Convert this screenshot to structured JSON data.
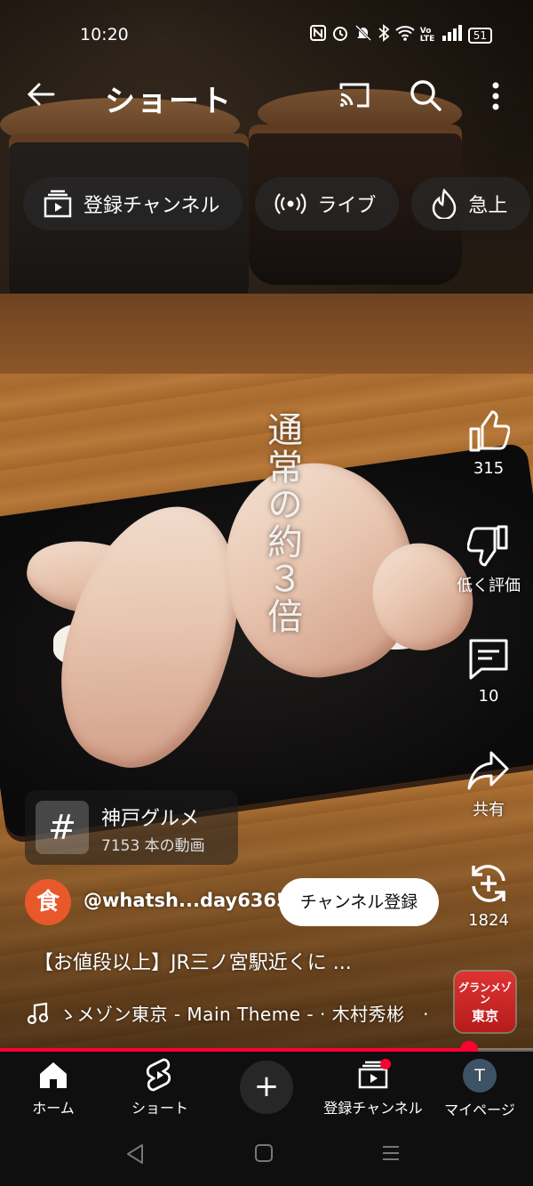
{
  "status_bar": {
    "time": "10:20",
    "battery": "51",
    "icons": [
      "nfc-icon",
      "alarm-icon",
      "mute-icon",
      "bluetooth-icon",
      "wifi-icon",
      "volte-icon",
      "signal-icon",
      "battery-icon"
    ],
    "volte_label": "Vo LTE"
  },
  "header": {
    "title": "ショート"
  },
  "chips": [
    {
      "label": "登録チャンネル",
      "icon": "subscriptions-icon"
    },
    {
      "label": "ライブ",
      "icon": "live-icon"
    },
    {
      "label": "急上",
      "icon": "trending-icon"
    }
  ],
  "video": {
    "overlay_caption": "通常の約３倍"
  },
  "actions": {
    "likes": "315",
    "dislike_label": "低く評価",
    "comments": "10",
    "share_label": "共有",
    "remix": "1824"
  },
  "hashtag": {
    "symbol": "#",
    "name": "神戸グルメ",
    "count": "7153 本の動画"
  },
  "channel": {
    "avatar_glyph": "食",
    "handle": "@whatsh...day6365",
    "subscribe_label": "チャンネル登録"
  },
  "video_title": "【お値段以上】JR三ノ宮駅近くに ...",
  "music": {
    "text": "ゝメゾン東京 - Main Theme - · 木村秀彬　·"
  },
  "sound_thumb": {
    "line1": "グランメゾン",
    "line2": "東京"
  },
  "progress": {
    "fraction": 0.88
  },
  "bottom_nav": {
    "home": "ホーム",
    "shorts": "ショート",
    "create": "+",
    "subscriptions": "登録チャンネル",
    "mypage": "マイページ",
    "mypage_avatar": "T"
  },
  "colors": {
    "accent": "#ff0033",
    "nav_bg": "#0f0f0f",
    "avatar_bg": "#e8582a"
  }
}
